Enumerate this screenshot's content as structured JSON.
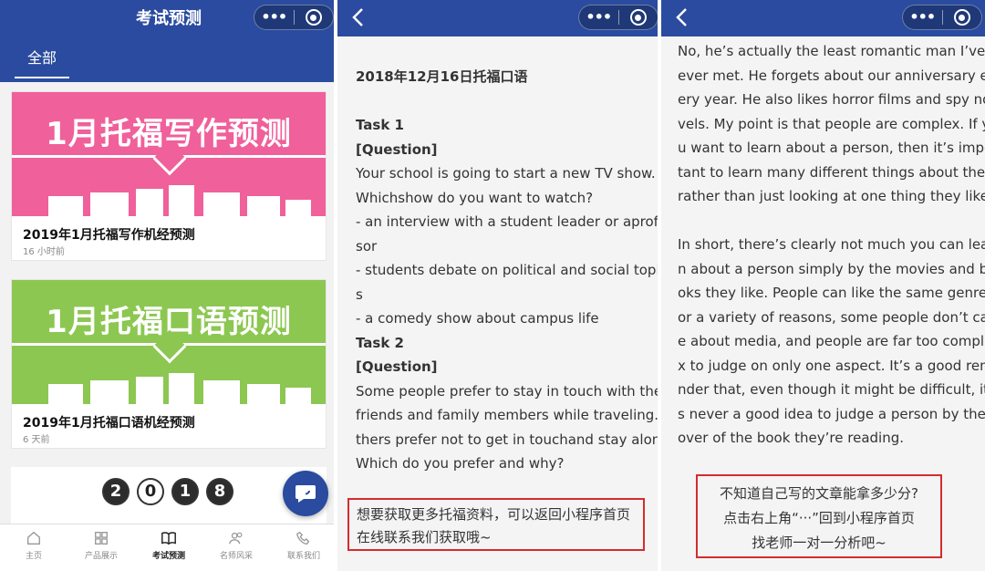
{
  "screen1": {
    "title": "考试预测",
    "tab": "全部",
    "cards": [
      {
        "banner": "1月托福写作预测",
        "title": "2019年1月托福写作机经预测",
        "time": "16 小时前",
        "color": "#f0609a"
      },
      {
        "banner": "1月托福口语预测",
        "title": "2019年1月托福口语机经预测",
        "time": "6 天前",
        "color": "#8cc751"
      }
    ],
    "card3_year": [
      "2",
      "0",
      "1",
      "8"
    ],
    "nav": [
      {
        "label": "主页",
        "icon": "home-icon"
      },
      {
        "label": "产品展示",
        "icon": "grid-icon"
      },
      {
        "label": "考试预测",
        "icon": "book-icon",
        "active": true
      },
      {
        "label": "名师风采",
        "icon": "people-icon"
      },
      {
        "label": "联系我们",
        "icon": "phone-icon"
      }
    ],
    "fab_icon": "chat-icon"
  },
  "screen2": {
    "lines": [
      {
        "text": "2018年12月16日托福口语",
        "bold": true
      },
      {
        "text": "",
        "bold": false
      },
      {
        "text": "Task 1",
        "bold": true
      },
      {
        "text": "[Question]",
        "bold": true
      },
      {
        "text": "Your school is going to start a new TV show.",
        "bold": false
      },
      {
        "text": "Whichshow do you want to watch?",
        "bold": false
      },
      {
        "text": "- an interview with a student leader or aprofes",
        "bold": false
      },
      {
        "text": "sor",
        "bold": false
      },
      {
        "text": "- students debate on political and social topic",
        "bold": false
      },
      {
        "text": "s",
        "bold": false
      },
      {
        "text": "- a comedy show about campus life",
        "bold": false
      },
      {
        "text": "Task 2",
        "bold": true
      },
      {
        "text": "[Question]",
        "bold": true
      },
      {
        "text": "Some people prefer to stay in touch with their",
        "bold": false
      },
      {
        "text": "friends and family members while traveling. O",
        "bold": false
      },
      {
        "text": "thers prefer not to get in touchand stay alone.",
        "bold": false
      },
      {
        "text": "Which do you prefer and why?",
        "bold": false
      }
    ],
    "notice": [
      "想要获取更多托福资料，可以返回小程序首页",
      "在线联系我们获取哦~"
    ]
  },
  "screen3": {
    "lines": [
      "No, he’s actually the least romantic man I’ve",
      "ever met. He forgets about our anniversary ev",
      "ery year. He also likes horror films and spy no",
      "vels. My point is that people are complex. If yo",
      "u want to learn about a person, then it’s impor",
      "tant to learn many different things about them",
      "rather than just looking at one thing they like.",
      "",
      "In short, there’s clearly not much you can lear",
      "n about a person simply by the movies and bo",
      "oks they like. People can like the same genre f",
      "or a variety of reasons, some people don’t car",
      "e about media, and people are far too comple",
      "x to judge on only one aspect. It’s a good remi",
      "nder that, even though it might be difficult, it’",
      "s never a good idea to judge a person by the c",
      "over of the book they’re reading."
    ],
    "notice": [
      "不知道自己写的文章能拿多少分?",
      "点击右上角“···”回到小程序首页",
      "找老师一对一分析吧~"
    ]
  },
  "colors": {
    "brand": "#2a4b9f",
    "pink": "#f0609a",
    "green": "#8cc751",
    "red": "#d42c2c"
  }
}
